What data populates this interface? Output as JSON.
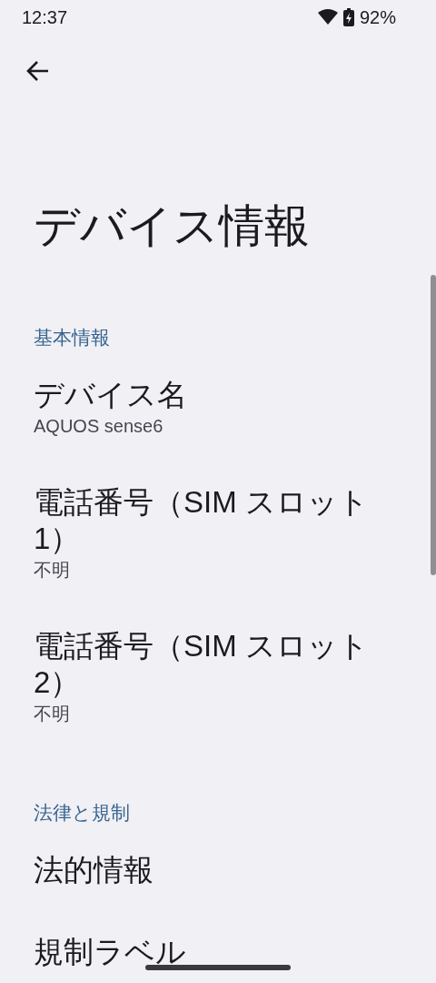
{
  "status_bar": {
    "time": "12:37",
    "battery": "92%"
  },
  "title": "デバイス情報",
  "sections": [
    {
      "header": "基本情報",
      "items": [
        {
          "title": "デバイス名",
          "summary": "AQUOS sense6"
        },
        {
          "title": "電話番号（SIM スロット 1）",
          "summary": "不明"
        },
        {
          "title": "電話番号（SIM スロット 2）",
          "summary": "不明"
        }
      ]
    },
    {
      "header": "法律と規制",
      "items": [
        {
          "title": "法的情報"
        },
        {
          "title": "規制ラベル"
        }
      ]
    }
  ]
}
